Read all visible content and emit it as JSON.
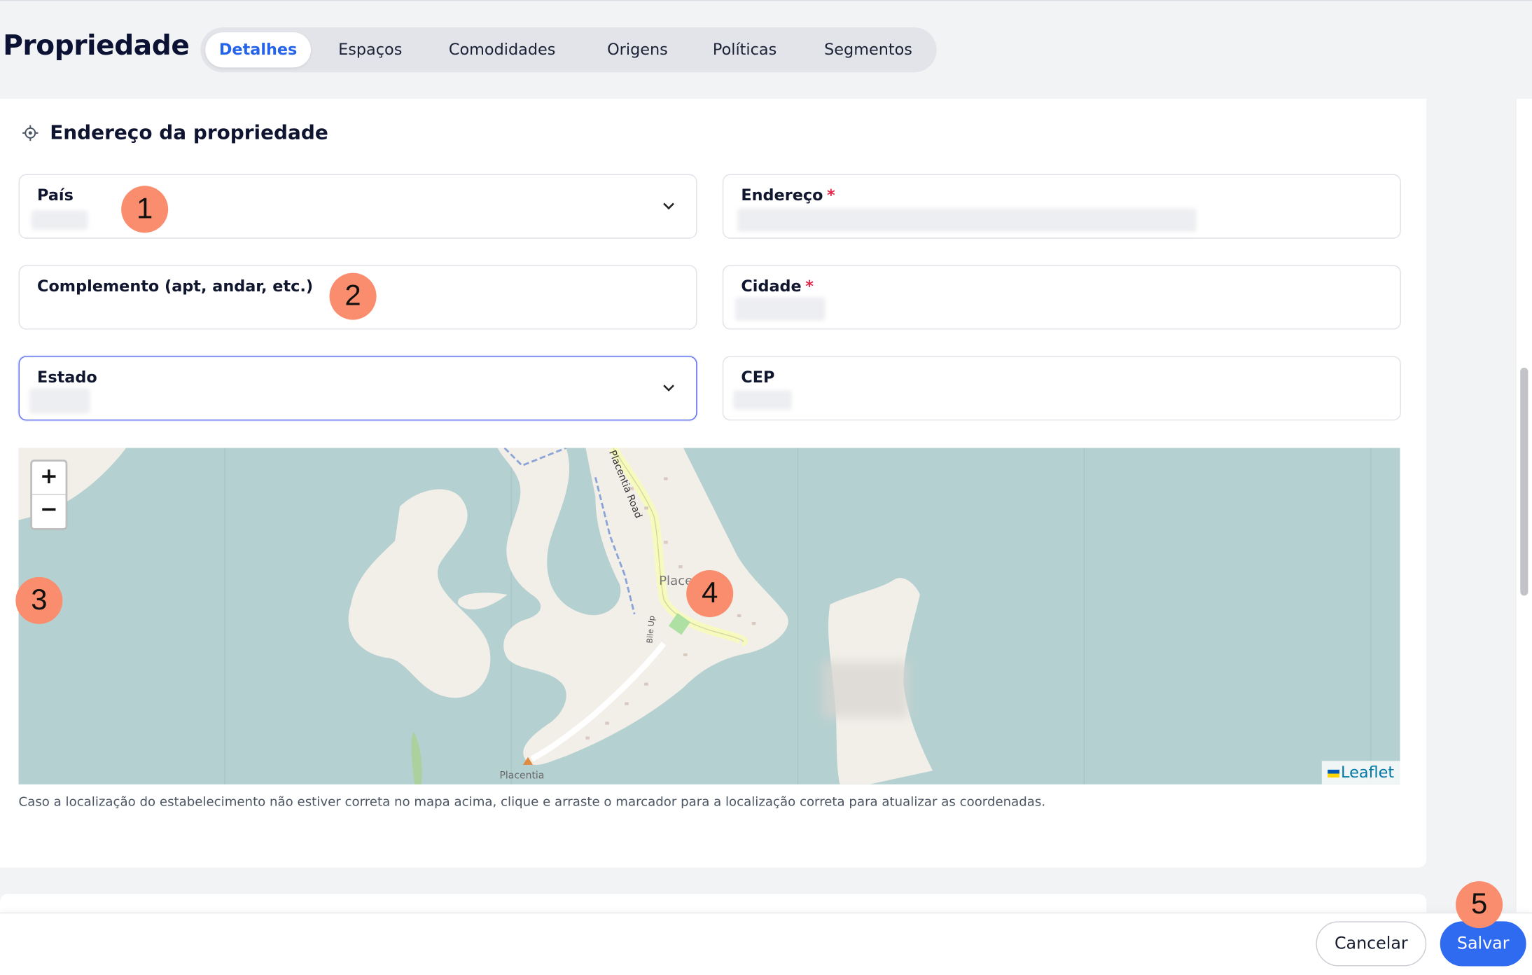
{
  "header": {
    "title": "Propriedade",
    "tabs": [
      {
        "label": "Detalhes",
        "active": true
      },
      {
        "label": "Espaços",
        "active": false
      },
      {
        "label": "Comodidades",
        "active": false
      },
      {
        "label": "Origens",
        "active": false
      },
      {
        "label": "Políticas",
        "active": false
      },
      {
        "label": "Segmentos",
        "active": false
      }
    ]
  },
  "section": {
    "title": "Endereço da propriedade",
    "icon": "location-target-icon"
  },
  "form": {
    "pais": {
      "label": "País",
      "type": "select"
    },
    "endereco": {
      "label": "Endereço",
      "required_mark": "*"
    },
    "complemento": {
      "label": "Complemento (apt, andar, etc.)"
    },
    "cidade": {
      "label": "Cidade",
      "required_mark": "*"
    },
    "estado": {
      "label": "Estado",
      "type": "select"
    },
    "cep": {
      "label": "CEP"
    }
  },
  "map": {
    "zoom_in": "+",
    "zoom_out": "−",
    "attribution": "Leaflet",
    "labels": {
      "road": "Placentia Road",
      "town": "Placentia",
      "town_partial": "Place",
      "side_street": "Bile Up"
    },
    "colors": {
      "water": "#b5d0d0",
      "land": "#f2efe9",
      "road": "#f7fabf"
    },
    "help_text": "Caso a localização do estabelecimento não estiver correta no mapa acima, clique e arraste o marcador para a localização correta para atualizar as coordenadas."
  },
  "footer": {
    "cancel_label": "Cancelar",
    "save_label": "Salvar"
  },
  "badges": [
    "1",
    "2",
    "3",
    "4",
    "5"
  ],
  "colors": {
    "accent": "#2f6bf0",
    "badge": "#f98d6d",
    "required": "#e0284a"
  }
}
